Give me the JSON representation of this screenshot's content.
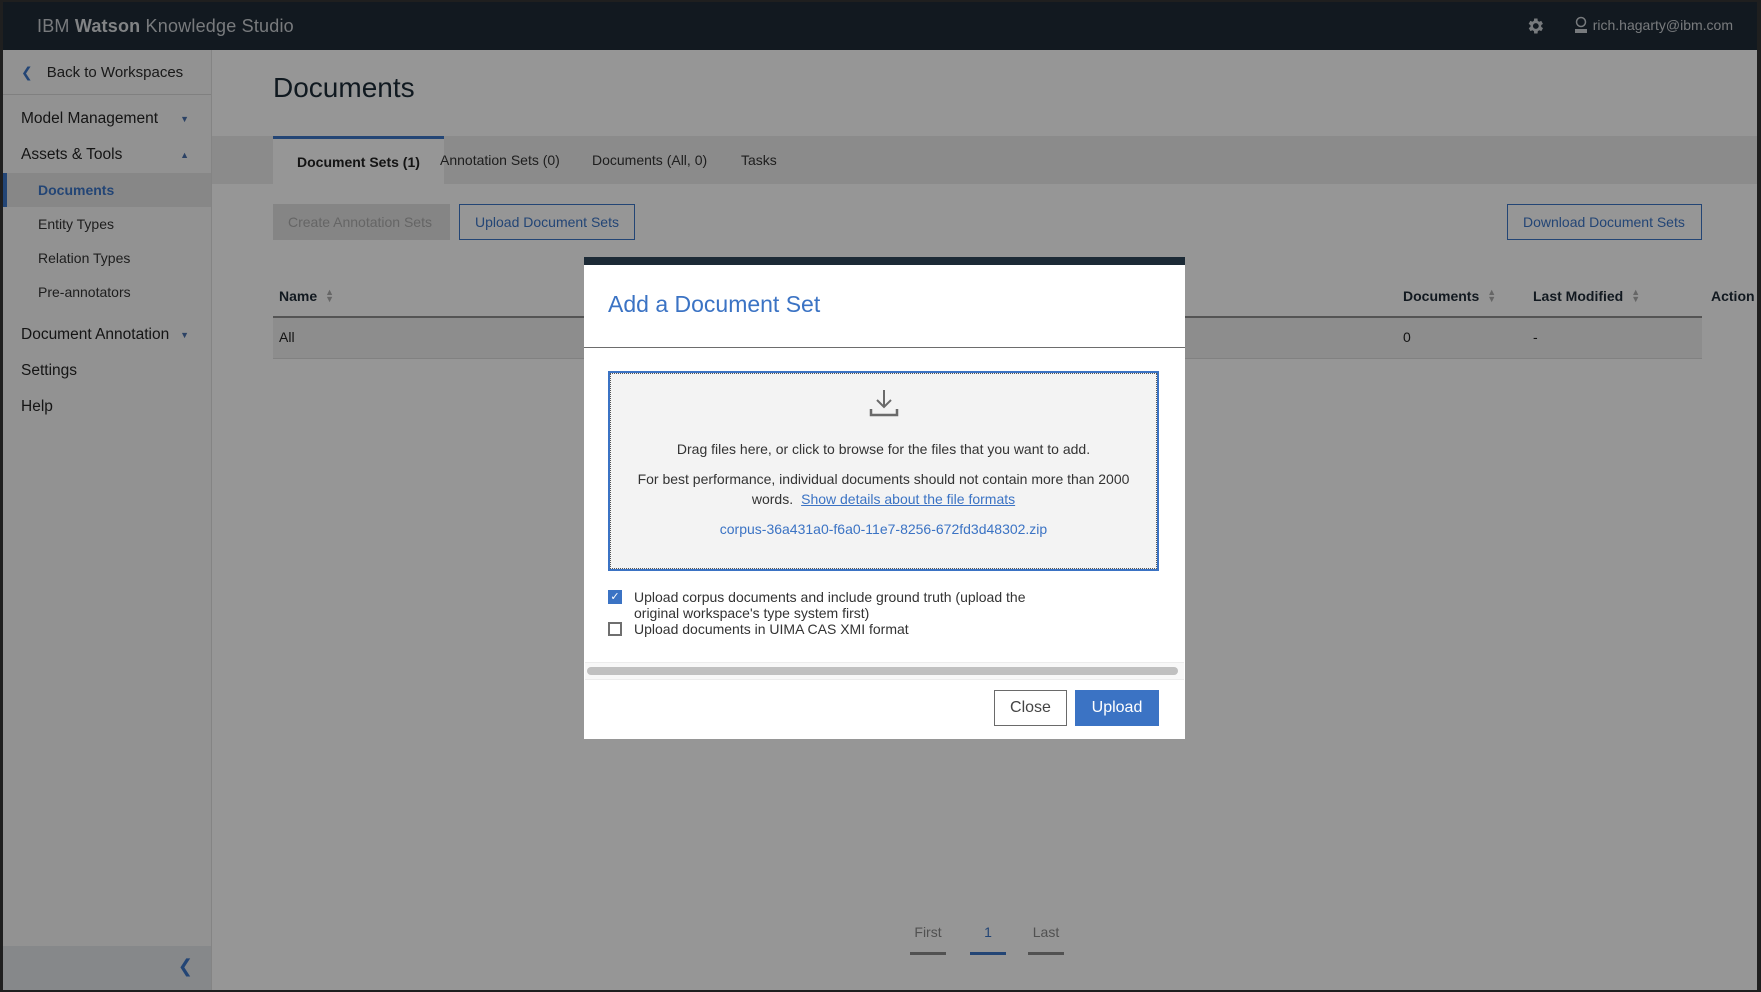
{
  "app": {
    "brand_prefix": "IBM ",
    "brand_bold": "Watson",
    "brand_suffix": " Knowledge Studio",
    "user_email": "rich.hagarty@ibm.com",
    "accent_color": "#3b73c4",
    "header_color": "#1f2b36"
  },
  "sidebar": {
    "back_label": "Back to Workspaces",
    "groups": [
      {
        "label": "Model Management",
        "expanded": false
      },
      {
        "label": "Assets & Tools",
        "expanded": true
      },
      {
        "label": "Document Annotation",
        "expanded": false
      },
      {
        "label": "Settings"
      },
      {
        "label": "Help"
      }
    ],
    "sub_items": [
      {
        "label": "Documents",
        "active": true
      },
      {
        "label": "Entity Types"
      },
      {
        "label": "Relation Types"
      },
      {
        "label": "Pre-annotators"
      }
    ]
  },
  "main": {
    "title": "Documents",
    "tabs": [
      {
        "label": "Document Sets (1)",
        "active": true
      },
      {
        "label": "Annotation Sets (0)"
      },
      {
        "label": "Documents (All, 0)"
      },
      {
        "label": "Tasks"
      }
    ],
    "buttons": {
      "create_annotation_sets": "Create Annotation Sets",
      "upload_document_sets": "Upload Document Sets",
      "download_document_sets": "Download Document Sets"
    },
    "table": {
      "columns": [
        "Name",
        "Documents",
        "Last Modified",
        "Action"
      ],
      "rows": [
        {
          "name": "All",
          "documents": "0",
          "last_modified": "-",
          "action": ""
        }
      ]
    },
    "pagination": {
      "first": "First",
      "current": "1",
      "last": "Last"
    }
  },
  "modal": {
    "title": "Add a Document Set",
    "dropzone": {
      "instruction": "Drag files here, or click to browse for the files that you want to add.",
      "performance_note": "For best performance, individual documents should not contain more than 2000 words.",
      "details_link": "Show details about the file formats",
      "selected_file": "corpus-36a431a0-f6a0-11e7-8256-672fd3d48302.zip"
    },
    "options": [
      {
        "label": "Upload corpus documents and include ground truth (upload the original workspace's type system first)",
        "checked": true
      },
      {
        "label": "Upload documents in UIMA CAS XMI format",
        "checked": false
      }
    ],
    "close_label": "Close",
    "upload_label": "Upload"
  }
}
